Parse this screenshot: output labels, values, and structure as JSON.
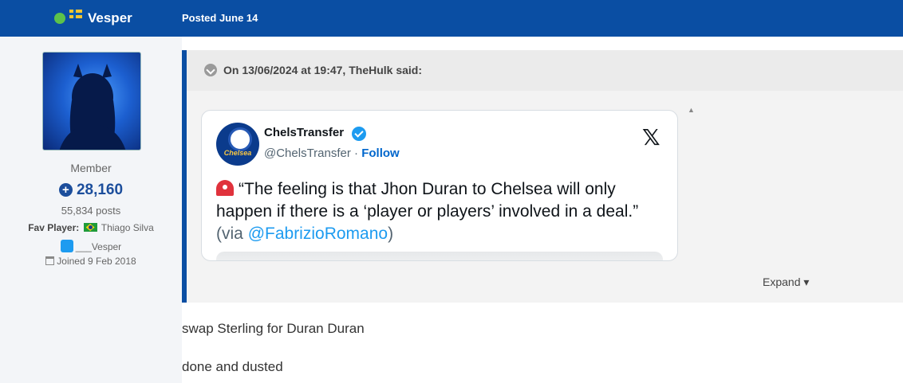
{
  "header": {
    "username": "Vesper",
    "posted": "Posted June 14"
  },
  "user": {
    "role": "Member",
    "reputation": "28,160",
    "posts": "55,834 posts",
    "fav_player_label": "Fav Player:",
    "fav_player": "Thiago Silva",
    "twitter": "___Vesper",
    "joined": "Joined 9 Feb 2018"
  },
  "quote": {
    "attribution": "On 13/06/2024 at 19:47, TheHulk said:",
    "expand_label": "Expand"
  },
  "tweet": {
    "name": "ChelsTransfer",
    "handle": "@ChelsTransfer",
    "separator": "·",
    "follow": "Follow",
    "avatar_text": "Chelsea",
    "text_main": "“The feeling is that Jhon Duran to Chelsea will only happen if there is a ‘player or players’ involved in a deal.”",
    "via_prefix": "(via ",
    "via_link": "@FabrizioRomano",
    "via_suffix": ")",
    "x_logo": "𝕏"
  },
  "post_body": [
    "swap Sterling for Duran Duran",
    "done and dusted"
  ],
  "colors": {
    "header_bg": "#0a4ea3",
    "online": "#5cc24b",
    "link": "#1d9bf0",
    "reputation": "#1c4e9c"
  }
}
